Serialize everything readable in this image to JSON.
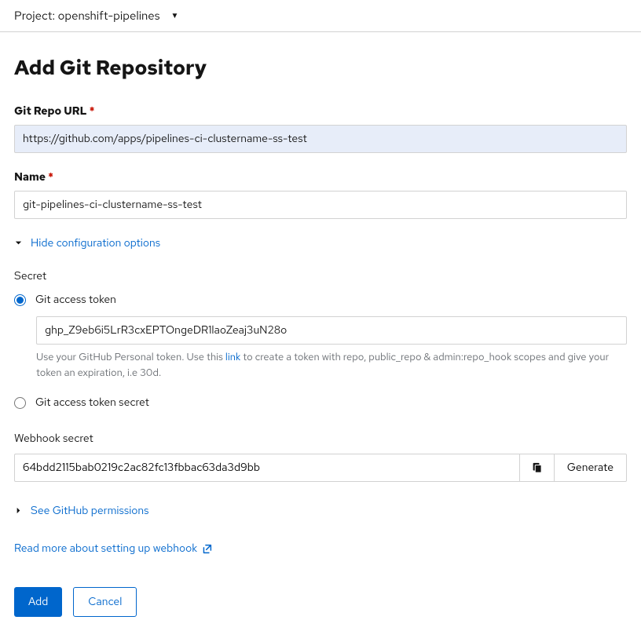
{
  "projectBar": {
    "label": "Project: openshift-pipelines"
  },
  "title": "Add Git Repository",
  "form": {
    "gitRepoUrl": {
      "label": "Git Repo URL",
      "value": "https://github.com/apps/pipelines-ci-clustername-ss-test"
    },
    "name": {
      "label": "Name",
      "value": "git-pipelines-ci-clustername-ss-test"
    },
    "hideConfig": "Hide configuration options",
    "secret": {
      "label": "Secret",
      "radioToken": "Git access token",
      "tokenValue": "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",
      "helpTextPrefix": "Use your GitHub Personal token. Use this ",
      "helpLink": "link",
      "helpTextSuffix": " to create a token with repo, public_repo & admin:repo_hook scopes and give your token an expiration, i.e 30d.",
      "radioSecret": "Git access token secret"
    },
    "webhook": {
      "label": "Webhook secret",
      "value": "64bdd2115bab0219c2ac82fc13fbbac63da3d9bb",
      "generate": "Generate"
    },
    "permissions": "See GitHub permissions",
    "readMore": "Read more about setting up webhook"
  },
  "buttons": {
    "add": "Add",
    "cancel": "Cancel"
  }
}
